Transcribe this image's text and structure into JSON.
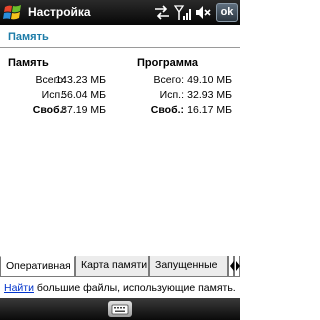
{
  "window": {
    "title": "Настройка",
    "ok_label": "ok",
    "status_icons": [
      "connectivity-icon",
      "signal-icon",
      "volume-icon"
    ]
  },
  "header": {
    "title": "Память"
  },
  "memory": {
    "storage": {
      "heading": "Память",
      "rows": [
        {
          "label": "Всего:",
          "value": "143.23 МБ",
          "bold": false
        },
        {
          "label": "Исп.:",
          "value": "56.04 МБ",
          "bold": false
        },
        {
          "label": "Своб.:",
          "value": "87.19 МБ",
          "bold": true
        }
      ]
    },
    "program": {
      "heading": "Программа",
      "rows": [
        {
          "label": "Всего:",
          "value": "49.10 МБ",
          "bold": false
        },
        {
          "label": "Исп.:",
          "value": "32.93 МБ",
          "bold": false
        },
        {
          "label": "Своб.:",
          "value": "16.17 МБ",
          "bold": true
        }
      ]
    }
  },
  "tabs": [
    {
      "label": "Оперативная",
      "active": true
    },
    {
      "label": "Карта памяти",
      "active": false
    },
    {
      "label": "Запущенные",
      "active": false
    }
  ],
  "hint": {
    "link": "Найти",
    "text": " большие файлы, использующие память."
  },
  "colors": {
    "title_accent": "#1d7ca8",
    "link": "#0033cc"
  }
}
